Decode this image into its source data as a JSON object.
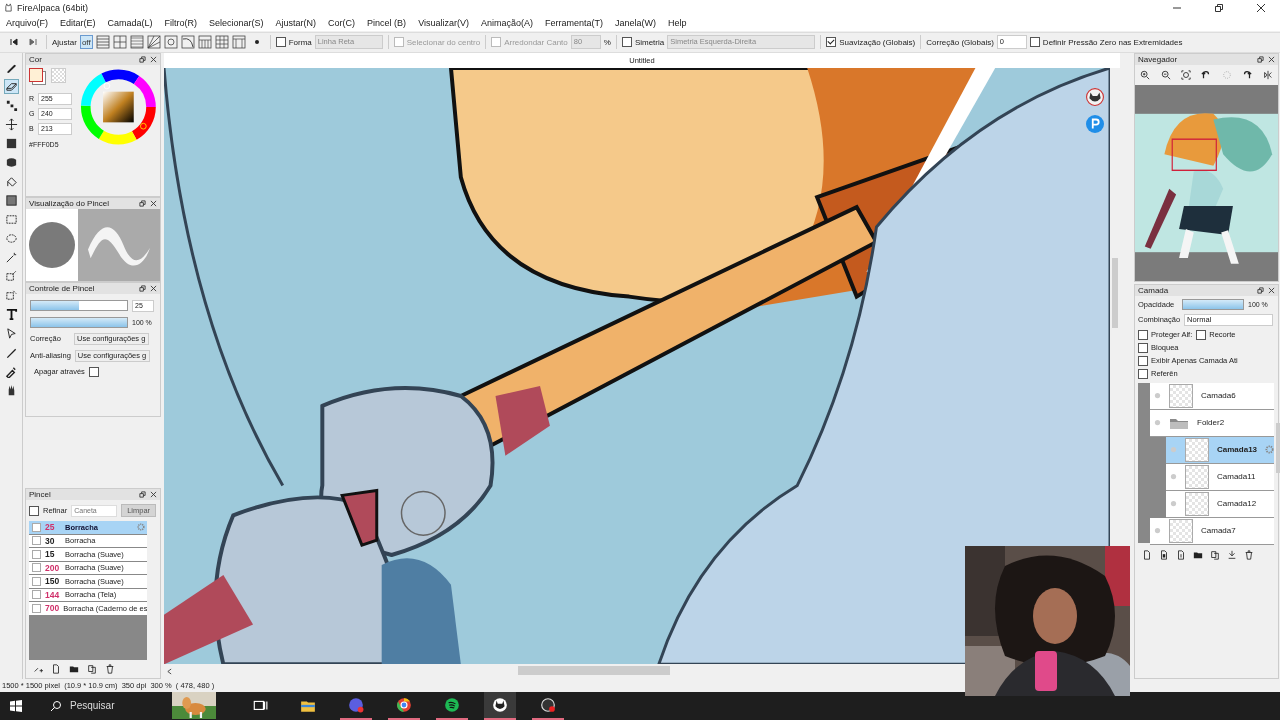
{
  "window": {
    "title": "FireAlpaca (64bit)"
  },
  "menu": [
    "Arquivo(F)",
    "Editar(E)",
    "Camada(L)",
    "Filtro(R)",
    "Selecionar(S)",
    "Ajustar(N)",
    "Cor(C)",
    "Pincel (B)",
    "Visualizar(V)",
    "Animação(A)",
    "Ferramenta(T)",
    "Janela(W)",
    "Help"
  ],
  "toolbar": {
    "adjust_label": "Ajustar",
    "snap_off_label": "off",
    "snaps": [
      {
        "kind": "off",
        "selected": true
      },
      {
        "kind": "parallel",
        "selected": false
      },
      {
        "kind": "cross",
        "selected": false
      },
      {
        "kind": "vanish",
        "selected": false
      },
      {
        "kind": "radial",
        "selected": false
      },
      {
        "kind": "concentric",
        "selected": false
      },
      {
        "kind": "curve",
        "selected": false
      },
      {
        "kind": "grid1",
        "selected": false
      },
      {
        "kind": "grid2",
        "selected": false
      },
      {
        "kind": "grid3",
        "selected": false
      }
    ],
    "shape": {
      "label": "Forma",
      "checked": false,
      "value": "Linha Reta"
    },
    "select_center": {
      "label": "Selecionar do centro",
      "checked": false
    },
    "round_corner": {
      "label": "Arredondar Canto",
      "checked": false,
      "value": "80",
      "unit": "%"
    },
    "symmetry": {
      "label": "Simetria",
      "checked": false,
      "value": "Simetria Esquerda-Direita"
    },
    "smoothing": {
      "label": "Suavização (Globais)",
      "checked": true
    },
    "correction": {
      "label": "Correção (Globais)",
      "value": "0"
    },
    "zero_pressure": {
      "label": "Definir Pressão Zero nas Extremidades",
      "checked": false
    }
  },
  "color_panel": {
    "title": "Cor",
    "r_label": "R",
    "r": "255",
    "g_label": "G",
    "g": "240",
    "b_label": "B",
    "b": "213",
    "hex": "#FFF0D5"
  },
  "brush_preview": {
    "title": "Visualização do Pincel"
  },
  "brush_control": {
    "title": "Controle de Pincel",
    "size_slider": {
      "level": 0.5
    },
    "size": "25",
    "opacity_slider": {
      "level": 1
    },
    "opacity": "100 %",
    "correction_label": "Correção",
    "correction_value": "Use configurações g",
    "antialias_label": "Anti-aliasing",
    "antialias_value": "Use configurações g",
    "erase_label": "Apagar através",
    "erase_checked": false
  },
  "brush_panel": {
    "title": "Pincel",
    "refine_label": "Refinar",
    "refine_checked": false,
    "search_placeholder": "Caneta",
    "clear_button": "Limpar",
    "brushes": [
      {
        "size": "25",
        "name": "Borracha",
        "selected": true,
        "color": "#d0306a"
      },
      {
        "size": "30",
        "name": "Borracha",
        "selected": false,
        "color": "#222222"
      },
      {
        "size": "15",
        "name": "Borracha (Suave)",
        "selected": false,
        "color": "#222222"
      },
      {
        "size": "200",
        "name": "Borracha (Suave)",
        "selected": false,
        "color": "#d0306a"
      },
      {
        "size": "150",
        "name": "Borracha (Suave)",
        "selected": false,
        "color": "#222222"
      },
      {
        "size": "144",
        "name": "Borracha (Tela)",
        "selected": false,
        "color": "#d0306a"
      },
      {
        "size": "700",
        "name": "Borracha (Caderno de es",
        "selected": false,
        "color": "#d0306a"
      }
    ]
  },
  "canvas": {
    "tab": "Untitled"
  },
  "navigator": {
    "title": "Navegador"
  },
  "layer_panel": {
    "title": "Camada",
    "opacity_label": "Opacidade",
    "opacity_slider": {
      "level": 1
    },
    "opacity": "100 %",
    "blend_label": "Combinação",
    "blend_value": "Normal",
    "options": [
      {
        "label": "Proteger Alf:",
        "checked": false
      },
      {
        "label": "Recorte",
        "checked": false
      },
      {
        "label": "Bloquea",
        "checked": false
      },
      {
        "label": "Exibir Apenas Camada Ati",
        "checked": false
      },
      {
        "label": "Referên",
        "checked": false
      }
    ],
    "layers": [
      {
        "kind": "layer",
        "name": "Camada6",
        "selected": false
      },
      {
        "kind": "folder",
        "name": "Folder2",
        "selected": false,
        "children": [
          {
            "kind": "layer",
            "name": "Camada13",
            "selected": true
          },
          {
            "kind": "layer",
            "name": "Camada11",
            "selected": false
          },
          {
            "kind": "layer",
            "name": "Camada12",
            "selected": false
          }
        ]
      },
      {
        "kind": "layer",
        "name": "Camada7",
        "selected": false
      }
    ]
  },
  "status_bar": "1500 * 1500 pixel  (10.9 * 10.9 cm)  350 dpi  300 %  ( 478, 480 )",
  "taskbar": {
    "search_placeholder": "Pesquisar"
  }
}
